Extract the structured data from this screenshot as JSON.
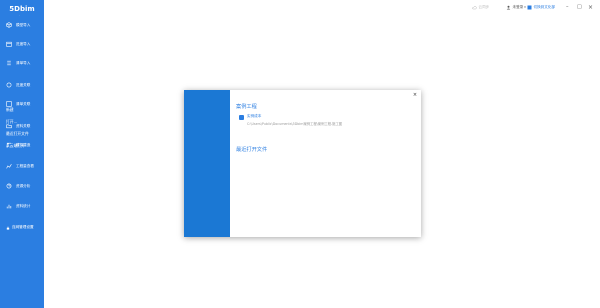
{
  "app": {
    "logo": "5Dbim",
    "logo_sub": "·"
  },
  "sidebar": {
    "items": [
      {
        "label": "模型导入",
        "icon": "cube-icon"
      },
      {
        "label": "进度导入",
        "icon": "calendar-icon"
      },
      {
        "label": "清单导入",
        "icon": "list-icon"
      },
      {
        "label": "进度关联",
        "icon": "link-icon"
      },
      {
        "label": "清单关联",
        "icon": "chain-icon"
      },
      {
        "label": "资料关联",
        "icon": "folder-icon"
      },
      {
        "label": "模拟建造",
        "icon": "crane-icon"
      },
      {
        "label": "工程量查看",
        "icon": "chart-icon"
      },
      {
        "label": "资源分析",
        "icon": "pie-icon"
      },
      {
        "label": "资料统计",
        "icon": "bar-icon"
      }
    ]
  },
  "topbar": {
    "cloud": "云同步",
    "user": "未登录",
    "feedback": "切换到文化部",
    "minimize": "–",
    "maximize": "□",
    "close": "×"
  },
  "modal": {
    "left": {
      "items": [
        "新建",
        "打开...",
        "最近打开文件",
        "从云端打开"
      ],
      "bottom": "连网管理设置"
    },
    "close": "×",
    "example_title": "案例工程",
    "project": {
      "name": "实例成本",
      "path": "C:\\Users\\Public\\Documents\\5Dbim案例工程\\案例工程-施工图"
    },
    "recent_title": "最近打开文件"
  },
  "colors": {
    "sidebar": "#2b7ee1",
    "modal_left": "#1b78d4",
    "accent": "#2b7ee1"
  }
}
